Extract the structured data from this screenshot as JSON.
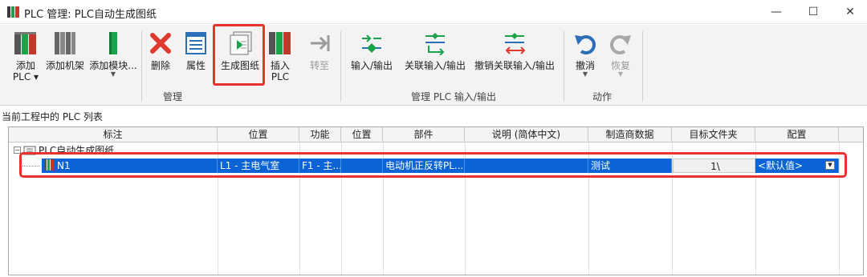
{
  "window": {
    "title": "PLC 管理: PLC自动生成图纸",
    "minimize_glyph": "—",
    "maximize_glyph": "☐",
    "close_glyph": "✕"
  },
  "ribbon": {
    "buttons": {
      "add_plc": {
        "label1": "添加",
        "label2": "PLC ▾"
      },
      "add_rack": {
        "label": "添加机架"
      },
      "add_module": {
        "label": "添加模块..."
      },
      "delete": {
        "label": "删除"
      },
      "properties": {
        "label": "属性"
      },
      "generate": {
        "label": "生成图纸"
      },
      "insert_plc": {
        "label1": "插入",
        "label2": "PLC"
      },
      "goto": {
        "label": "转至"
      },
      "io": {
        "label": "输入/输出"
      },
      "link_io": {
        "label": "关联输入/输出"
      },
      "unlink_io": {
        "label": "撤销关联输入/输出"
      },
      "undo": {
        "label": "撤消"
      },
      "redo": {
        "label": "恢复"
      }
    },
    "groups": {
      "manage": "管理",
      "manage_plc_io": "管理 PLC 输入/输出",
      "actions": "动作"
    }
  },
  "list": {
    "caption": "当前工程中的 PLC 列表",
    "columns": [
      "标注",
      "位置",
      "功能",
      "位置",
      "部件",
      "说明 (简体中文)",
      "制造商数据",
      "目标文件夹",
      "配置"
    ],
    "tree_root": "PLC自动生成图纸",
    "rows": [
      {
        "label": "N1",
        "location": "L1 - 主电气室",
        "function": "F1 - 主...",
        "position": "",
        "part": "电动机正反转PL...",
        "description": "",
        "manufacturer": "测试",
        "target_folder": "1\\",
        "config": "<默认值>"
      }
    ]
  },
  "colors": {
    "selection": "#0a64d6",
    "highlight_border": "#e8322f",
    "icon_green": "#1aa34a",
    "icon_red": "#e03a2f",
    "icon_blue": "#2a6fb8"
  }
}
